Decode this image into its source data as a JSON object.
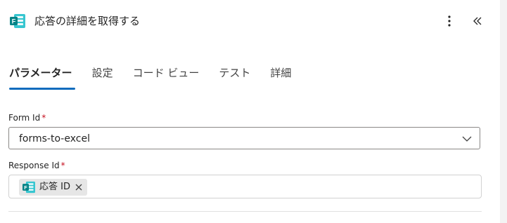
{
  "header": {
    "icon": "microsoft-forms-icon",
    "title": "応答の詳細を取得する",
    "more_icon": "more-vertical-icon",
    "collapse_icon": "double-chevron-left-icon"
  },
  "tabs": [
    {
      "label": "パラメーター",
      "active": true
    },
    {
      "label": "設定",
      "active": false
    },
    {
      "label": "コード ビュー",
      "active": false
    },
    {
      "label": "テスト",
      "active": false
    },
    {
      "label": "詳細",
      "active": false
    }
  ],
  "form_id": {
    "label": "Form Id",
    "required_mark": "*",
    "value": "forms-to-excel",
    "dropdown_icon": "chevron-down-icon"
  },
  "response_id": {
    "label": "Response Id",
    "required_mark": "*",
    "token": {
      "icon": "microsoft-forms-icon",
      "label": "応答 ID",
      "remove_icon": "close-icon"
    }
  },
  "colors": {
    "accent": "#0f6cbd",
    "required": "#c50f1f",
    "forms_teal": "#038387"
  }
}
